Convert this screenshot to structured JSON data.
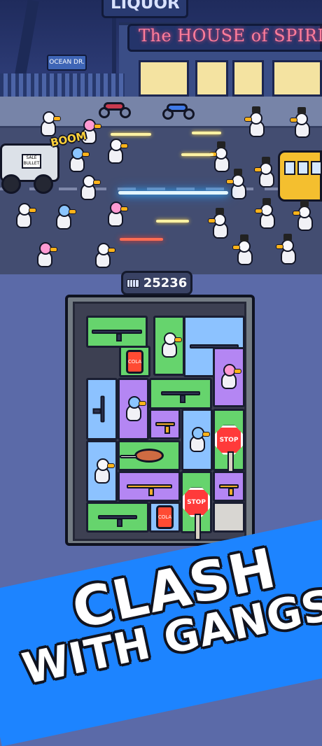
{
  "scene": {
    "top_sign": "LIQUOR",
    "store_sign": "The HOUSE of SPIRIT",
    "street_sign": "OCEAN DR.",
    "effect_text": "BOOM",
    "truck_panel": "SALE BULLET"
  },
  "score": {
    "value": "25236",
    "icon": "fist-icon"
  },
  "inventory": {
    "items": [
      {
        "label": "sniper rifle",
        "color": "green"
      },
      {
        "label": "duck",
        "color": "green"
      },
      {
        "label": "minigun",
        "color": "blue"
      },
      {
        "label": "cola",
        "color": "green"
      },
      {
        "label": "duck",
        "color": "purple"
      },
      {
        "label": "plasma rifle",
        "color": "blue"
      },
      {
        "label": "duck",
        "color": "purple"
      },
      {
        "label": "assault rifle",
        "color": "green"
      },
      {
        "label": "pistol",
        "color": "purple"
      },
      {
        "label": "duck",
        "color": "blue"
      },
      {
        "label": "STOP",
        "color": "green"
      },
      {
        "label": "duck",
        "color": "blue"
      },
      {
        "label": "meat club",
        "color": "green"
      },
      {
        "label": "gold rifle",
        "color": "purple"
      },
      {
        "label": "STOP",
        "color": "green"
      },
      {
        "label": "pistol",
        "color": "purple"
      },
      {
        "label": "assault rifle",
        "color": "green"
      },
      {
        "label": "cola",
        "color": "blue"
      },
      {
        "label": "",
        "color": "empty"
      }
    ]
  },
  "banner": {
    "line1": "CLASH",
    "line2": "WITH GANGS!"
  },
  "colors": {
    "green": "#66d46d",
    "blue": "#8cc2ff",
    "purple": "#b486f3",
    "banner": "#1d84ff"
  }
}
